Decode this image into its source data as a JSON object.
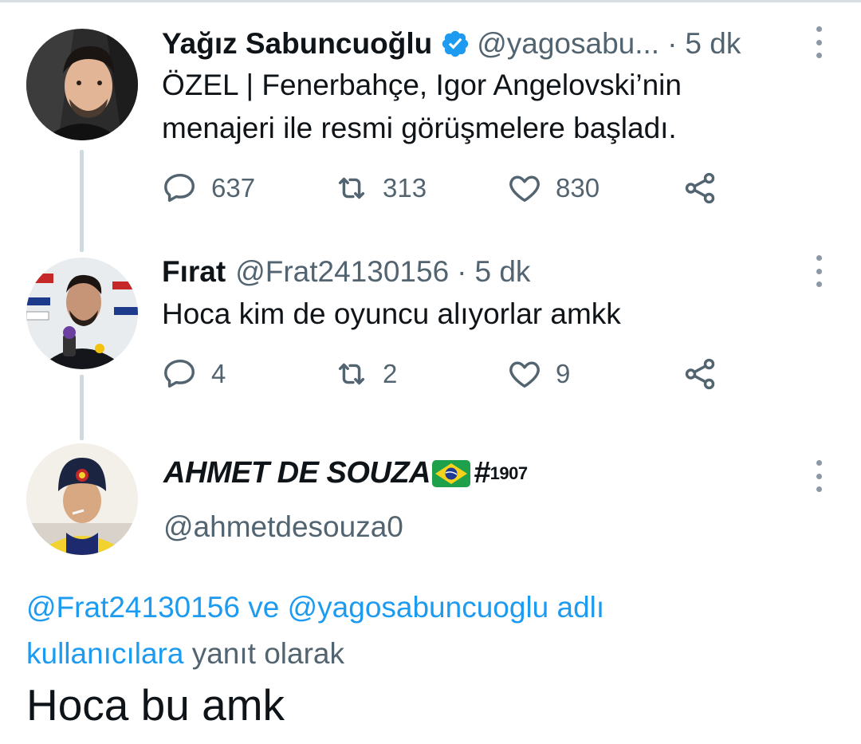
{
  "tweets": [
    {
      "author_name": "Yağız Sabuncuoğlu",
      "verified": true,
      "handle": "@yagosabu...",
      "separator": "·",
      "time": "5 dk",
      "text_lines": [
        "ÖZEL | Fenerbahçe, Igor Angelovski’nin",
        "menajeri ile resmi görüşmelere başladı."
      ],
      "replies": "637",
      "retweets": "313",
      "likes": "830"
    },
    {
      "author_name": "Fırat",
      "handle": "@Frat24130156",
      "separator": "·",
      "time": "5 dk",
      "text_lines": [
        "Hoca kim de oyuncu alıyorlar amkk"
      ],
      "replies": "4",
      "retweets": "2",
      "likes": "9"
    }
  ],
  "reply": {
    "author_name": "AHMET DE SOUZA",
    "author_suffix": "#",
    "author_sup": "1907",
    "handle": "@ahmetdesouza0",
    "mention1": "@Frat24130156",
    "connector": " ve ",
    "mention2": "@yagosabuncuoglu adlı",
    "mention3": "kullanıcılara",
    "replying_suffix": " yanıt olarak",
    "text": "Hoca bu amk"
  },
  "icons": {
    "reply": "comment-bubble-icon",
    "retweet": "retweet-icon",
    "like": "heart-icon",
    "share": "share-icon",
    "more": "more-vertical-icon",
    "verified": "verified-badge-icon",
    "flag": "brazil-flag-icon"
  },
  "colors": {
    "accent": "#1d9bf0",
    "secondary_text": "#536471",
    "thread_line": "#cfd9de"
  }
}
